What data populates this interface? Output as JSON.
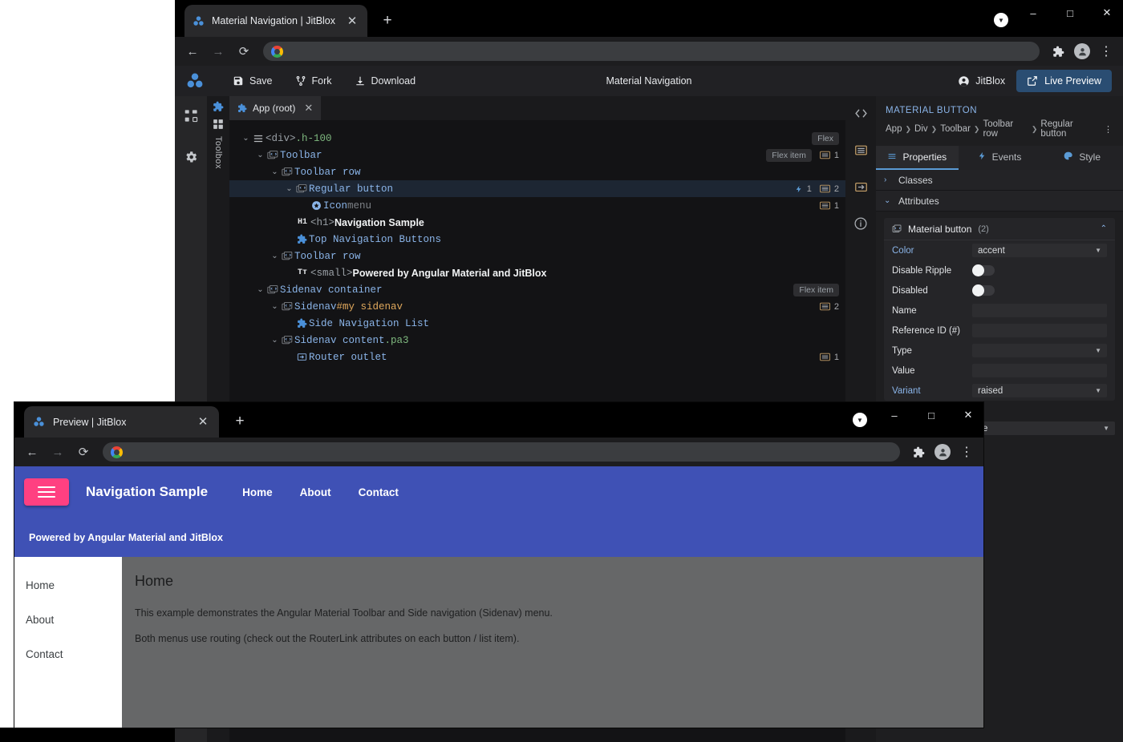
{
  "main_window": {
    "tab": {
      "title": "Material Navigation | JitBlox",
      "close": "✕",
      "newtab": "+"
    },
    "window_controls": {
      "minimize": "–",
      "maximize": "□",
      "close": "✕",
      "download_badge": "▼"
    },
    "nav": {
      "back": "←",
      "forward": "→",
      "reload": "⟳",
      "url": "",
      "placeholder": "",
      "extensions": "✦",
      "menu": "⋮"
    }
  },
  "jitblox": {
    "toolbar": {
      "save_label": "Save",
      "fork_label": "Fork",
      "download_label": "Download",
      "doc_title": "Material Navigation",
      "user_label": "JitBlox",
      "live_preview_label": "Live Preview"
    },
    "rail": [
      {
        "name": "project-structure-icon"
      },
      {
        "name": "settings-icon"
      }
    ],
    "toolbox_label": "Toolbox",
    "editor_tab": {
      "label": "App (root)",
      "close": "✕"
    },
    "tree": [
      {
        "indent": 0,
        "caret": "⌄",
        "icon": "layers-icon",
        "kind": "tag",
        "tag": "<div>",
        "cls": ".h-100",
        "pill": "Flex",
        "pill2": "",
        "events": "",
        "styles": ""
      },
      {
        "indent": 1,
        "caret": "⌄",
        "icon": "component-icon",
        "kind": "name",
        "name": "Toolbar",
        "pill": "",
        "pill2": "Flex item",
        "events": "",
        "styles": "1"
      },
      {
        "indent": 2,
        "caret": "⌄",
        "icon": "component-icon",
        "kind": "name",
        "name": "Toolbar row",
        "pill": "",
        "pill2": "",
        "events": "",
        "styles": ""
      },
      {
        "indent": 3,
        "caret": "⌄",
        "icon": "component-icon",
        "kind": "name",
        "name": "Regular button",
        "selected": true,
        "pill": "",
        "pill2": "",
        "events": "1",
        "styles": "2"
      },
      {
        "indent": 4,
        "caret": "",
        "icon": "material-icon",
        "kind": "name-muted",
        "name": "Icon",
        "muted": "menu",
        "pill": "",
        "pill2": "",
        "events": "",
        "styles": "1"
      },
      {
        "indent": 3,
        "caret": "",
        "icon": "h1-icon",
        "kind": "text",
        "badge": "H1",
        "tag": "<h1>",
        "text": "Navigation Sample",
        "pill": "",
        "pill2": "",
        "events": "",
        "styles": ""
      },
      {
        "indent": 3,
        "caret": "",
        "icon": "puzzle-icon",
        "kind": "name",
        "name": "Top Navigation Buttons",
        "pill": "",
        "pill2": "",
        "events": "",
        "styles": ""
      },
      {
        "indent": 2,
        "caret": "⌄",
        "icon": "component-icon",
        "kind": "name",
        "name": "Toolbar row",
        "pill": "",
        "pill2": "",
        "events": "",
        "styles": ""
      },
      {
        "indent": 3,
        "caret": "",
        "icon": "text-icon",
        "kind": "text",
        "badge": "Tт",
        "tag": "<small>",
        "text": "Powered by Angular Material and JitBlox",
        "pill": "",
        "pill2": "",
        "events": "",
        "styles": ""
      },
      {
        "indent": 1,
        "caret": "⌄",
        "icon": "component-icon",
        "kind": "name",
        "name": "Sidenav container",
        "pill": "",
        "pill2": "Flex item",
        "events": "",
        "styles": ""
      },
      {
        "indent": 2,
        "caret": "⌄",
        "icon": "component-icon",
        "kind": "name-id",
        "name": "Sidenav",
        "id": "#my sidenav",
        "pill": "",
        "pill2": "",
        "events": "",
        "styles": "2"
      },
      {
        "indent": 3,
        "caret": "",
        "icon": "puzzle-icon",
        "kind": "name",
        "name": "Side Navigation List",
        "pill": "",
        "pill2": "",
        "events": "",
        "styles": ""
      },
      {
        "indent": 2,
        "caret": "⌄",
        "icon": "component-icon",
        "kind": "name-cls",
        "name": "Sidenav content",
        "cls": ".pa3",
        "pill": "",
        "pill2": "",
        "events": "",
        "styles": ""
      },
      {
        "indent": 3,
        "caret": "",
        "icon": "router-icon",
        "kind": "name",
        "name": "Router outlet",
        "pill": "",
        "pill2": "",
        "events": "",
        "styles": "1"
      }
    ],
    "right_strip": [
      {
        "name": "code-icon",
        "glyph": "<>"
      },
      {
        "name": "list-icon",
        "glyph": "☰"
      },
      {
        "name": "import-icon",
        "glyph": "⇥"
      },
      {
        "name": "info-icon",
        "glyph": "ⓘ"
      }
    ],
    "inspector": {
      "title": "MATERIAL BUTTON",
      "breadcrumb": [
        "App",
        "Div",
        "Toolbar",
        "Toolbar row",
        "Regular button"
      ],
      "breadcrumb_menu": "⋮",
      "tabs": [
        {
          "label": "Properties",
          "icon": "list-icon",
          "active": true
        },
        {
          "label": "Events",
          "icon": "bolt-icon",
          "active": false
        },
        {
          "label": "Style",
          "icon": "palette-icon",
          "active": false
        }
      ],
      "sections": [
        {
          "label": "Classes",
          "expanded": false,
          "chev": "›"
        },
        {
          "label": "Attributes",
          "expanded": true,
          "chev": "⌄"
        }
      ],
      "group": {
        "label": "Material button",
        "count": "(2)",
        "collapse": "⌃",
        "icon": "component-icon"
      },
      "properties": [
        {
          "label": "Color",
          "type": "select",
          "value": "accent",
          "accent": true
        },
        {
          "label": "Disable Ripple",
          "type": "toggle",
          "value": "off",
          "accent": false
        },
        {
          "label": "Disabled",
          "type": "toggle",
          "value": "off",
          "accent": false
        },
        {
          "label": "Name",
          "type": "text",
          "value": "",
          "accent": false
        },
        {
          "label": "Reference ID (#)",
          "type": "text",
          "value": "",
          "accent": false
        },
        {
          "label": "Type",
          "type": "select",
          "value": "",
          "accent": false
        },
        {
          "label": "Value",
          "type": "text",
          "value": "",
          "accent": false
        },
        {
          "label": "Variant",
          "type": "select",
          "value": "raised",
          "accent": true
        }
      ],
      "occluded_field": {
        "value": "ame"
      }
    }
  },
  "preview_window": {
    "tab": {
      "title": "Preview | JitBlox",
      "close": "✕",
      "newtab": "+"
    },
    "window_controls": {
      "minimize": "–",
      "maximize": "□",
      "close": "✕",
      "download_badge": "▼"
    },
    "nav": {
      "back": "←",
      "forward": "→",
      "reload": "⟳",
      "url": "",
      "extensions": "✦",
      "menu": "⋮"
    },
    "app": {
      "toolbar": {
        "menu_button": "hamburger-icon",
        "title": "Navigation Sample",
        "links": [
          "Home",
          "About",
          "Contact"
        ],
        "subtitle": "Powered by Angular Material and JitBlox",
        "bg_color": "#3f51b5",
        "accent_color": "#ff4081"
      },
      "sidenav": [
        "Home",
        "About",
        "Contact"
      ],
      "content": {
        "heading": "Home",
        "paragraphs": [
          "This example demonstrates the Angular Material Toolbar and Side navigation (Sidenav) menu.",
          "Both menus use routing (check out the RouterLink attributes on each button / list item)."
        ]
      }
    }
  }
}
